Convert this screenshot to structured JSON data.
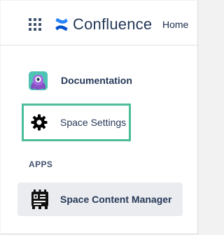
{
  "header": {
    "app_switcher_icon": "app-grid-icon",
    "logo_icon": "confluence-logo-icon",
    "logo_text": "Confluence",
    "home_label": "Home",
    "logo_color": "#2684ff"
  },
  "sidebar": {
    "items": [
      {
        "label": "Documentation",
        "icon": "space-avatar-icon"
      },
      {
        "label": "Space Settings",
        "icon": "gear-icon",
        "highlighted": true,
        "highlight_color": "#4bbd9a"
      }
    ],
    "apps_heading": "APPS",
    "apps": [
      {
        "label": "Space Content Manager",
        "icon": "space-content-manager-icon",
        "selected": true
      }
    ]
  }
}
